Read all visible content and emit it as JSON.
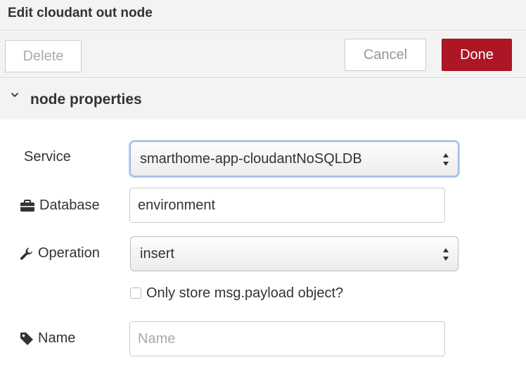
{
  "dialog": {
    "title": "Edit cloudant out node"
  },
  "buttons": {
    "delete": "Delete",
    "cancel": "Cancel",
    "done": "Done"
  },
  "colors": {
    "done_bg": "#ad1625",
    "panel_bg": "#f3f3f3",
    "focus_ring": "#b9cff0"
  },
  "section": {
    "title": "node properties",
    "icon": "chevron-down-icon"
  },
  "form": {
    "service": {
      "label": "Service",
      "value": "smarthome-app-cloudantNoSQLDB"
    },
    "database": {
      "label": "Database",
      "icon": "briefcase-icon",
      "value": "environment"
    },
    "operation": {
      "label": "Operation",
      "icon": "wrench-icon",
      "value": "insert"
    },
    "payload_only": {
      "label": "Only store msg.payload object?",
      "checked": false
    },
    "name": {
      "label": "Name",
      "icon": "tag-icon",
      "value": "",
      "placeholder": "Name"
    }
  }
}
